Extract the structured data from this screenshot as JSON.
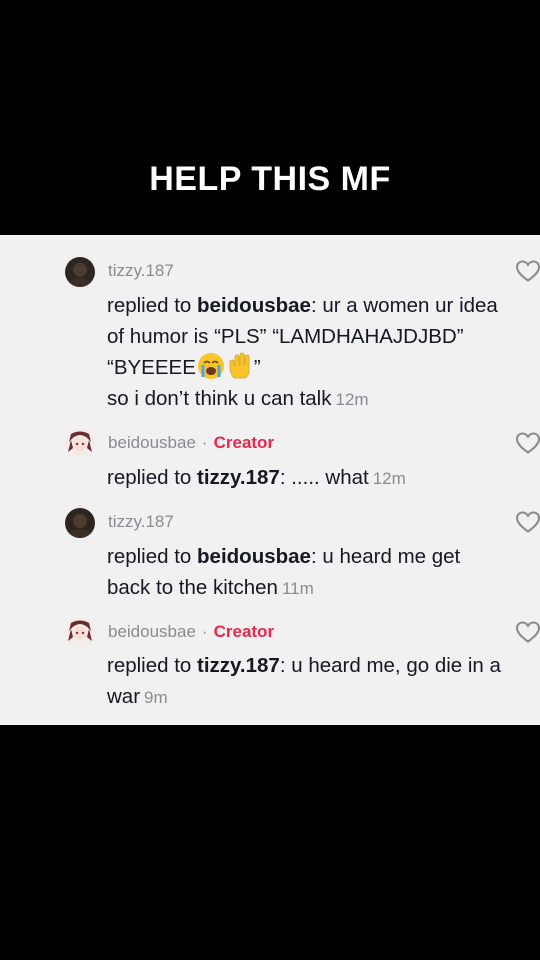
{
  "caption": "HELP THIS MF",
  "comments": [
    {
      "username": "tizzy.187",
      "creator_label": "",
      "reply_prefix": "replied to ",
      "reply_target": "beidousbae",
      "text_parts": [
        ": ur a women ur idea of humor is “PLS” “LAMDHAHAJDJBD” “BYEEEE",
        "”",
        " so i don’t think u can talk"
      ],
      "emojis": [
        "crying-face",
        "raised-hand"
      ],
      "time": "12m"
    },
    {
      "username": "beidousbae",
      "creator_label": "Creator",
      "reply_prefix": "replied to ",
      "reply_target": "tizzy.187",
      "text": ": ..... what",
      "time": "12m"
    },
    {
      "username": "tizzy.187",
      "creator_label": "",
      "reply_prefix": "replied to ",
      "reply_target": "beidousbae",
      "text": ": u heard me get back to the kitchen",
      "time": "11m"
    },
    {
      "username": "beidousbae",
      "creator_label": "Creator",
      "reply_prefix": "replied to ",
      "reply_target": "tizzy.187",
      "text": ": u heard me, go die in a war",
      "time": "9m"
    }
  ],
  "separator": "·",
  "icons": {
    "like": "heart-outline-icon",
    "avatar_1": "dark-avatar",
    "avatar_2": "character-avatar"
  },
  "colors": {
    "panel_bg": "#f1f1f2",
    "creator": "#e8284d",
    "meta": "#8a8b91",
    "text": "#161823"
  }
}
